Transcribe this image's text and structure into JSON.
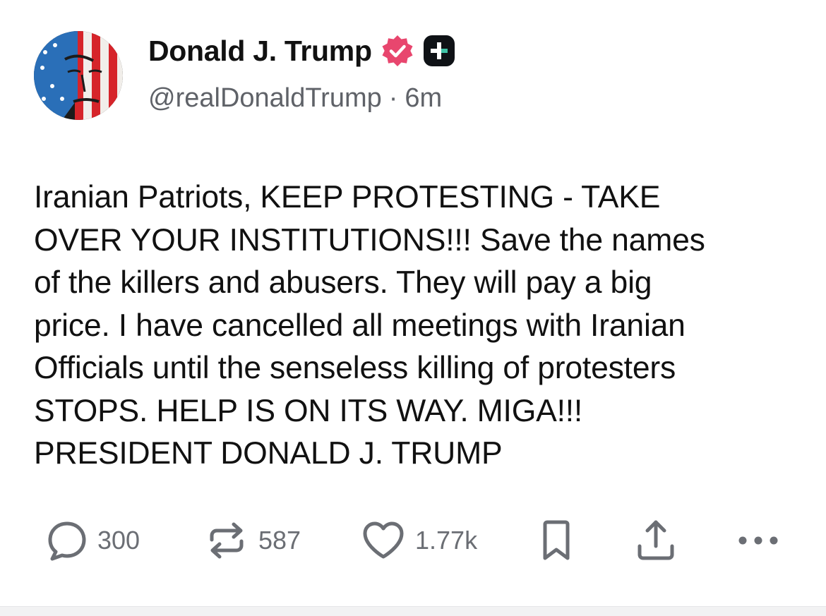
{
  "post": {
    "author": {
      "display_name": "Donald J. Trump",
      "handle": "@realDonaldTrump",
      "separator": "·",
      "time_ago": "6m",
      "avatar_icon": "avatar-flag-portrait",
      "verified_icon": "verified-badge-icon",
      "verified_color": "#e8466e",
      "plus_icon": "plus-badge-icon"
    },
    "body_lines": [
      "Iranian Patriots, KEEP PROTESTING - TAKE",
      "OVER YOUR INSTITUTIONS!!! Save the names",
      "of the killers and abusers. They will pay a big",
      "price. I have cancelled all meetings with Iranian",
      "Officials until the senseless killing of protesters",
      "STOPS. HELP IS ON ITS WAY. MIGA!!!",
      "PRESIDENT DONALD J. TRUMP"
    ],
    "actions": {
      "replies": {
        "icon": "reply-bubble-icon",
        "count": "300"
      },
      "retruths": {
        "icon": "retruth-icon",
        "count": "587"
      },
      "likes": {
        "icon": "heart-icon",
        "count": "1.77k"
      },
      "bookmark": {
        "icon": "bookmark-icon"
      },
      "share": {
        "icon": "share-icon"
      },
      "more": {
        "icon": "more-icon"
      }
    },
    "colors": {
      "text": "#111111",
      "secondary_text": "#5f6268",
      "action_icon": "#6b6e74"
    }
  }
}
